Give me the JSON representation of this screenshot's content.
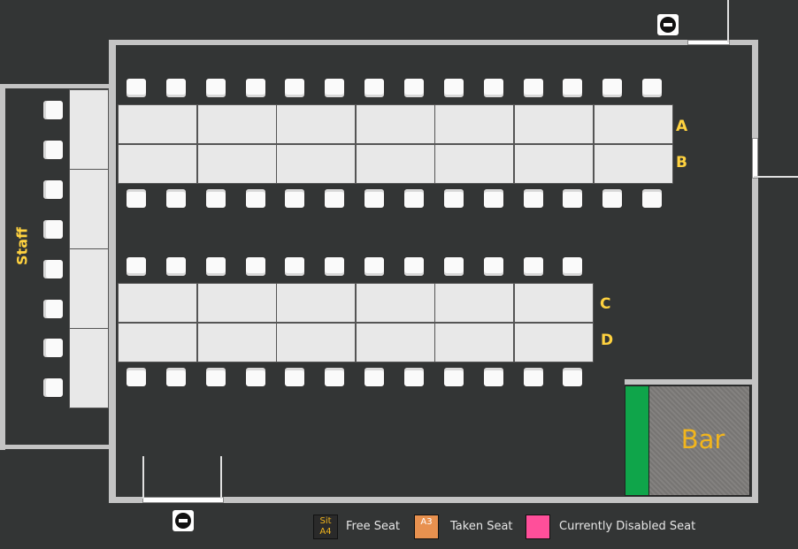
{
  "rows": {
    "a": "A",
    "b": "B",
    "c": "C",
    "d": "D"
  },
  "staff_label": "Staff",
  "bar_label": "Bar",
  "legend": {
    "free": {
      "swatch_line1": "Sit",
      "swatch_line2": "A4",
      "label": "Free Seat"
    },
    "taken": {
      "swatch_text": "A3",
      "label": "Taken Seat"
    },
    "disabled": {
      "label": "Currently Disabled Seat"
    }
  },
  "colors": {
    "background": "#333535",
    "wall": "#c4c4c4",
    "table": "#e8e8e8",
    "row_label": "#ffd23f",
    "bar_green": "#0fa54a",
    "bar_counter": "#7d7b79",
    "free_swatch": "#2a2a2a",
    "taken_swatch": "#e8914f",
    "disabled_swatch": "#ff4f9a"
  },
  "icons": {
    "exit_top": "no-entry-icon",
    "exit_bottom": "no-entry-icon",
    "seat": "chair-icon"
  }
}
